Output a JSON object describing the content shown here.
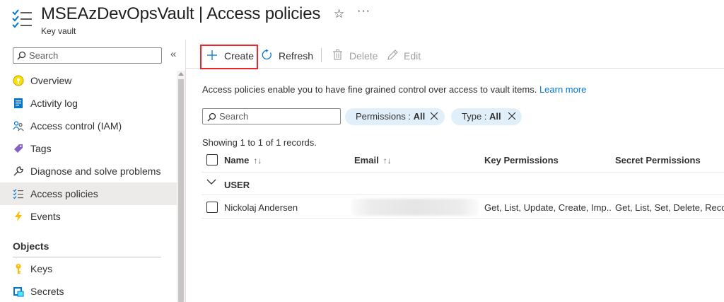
{
  "header": {
    "title": "MSEAzDevOpsVault | Access policies",
    "subtitle": "Key vault",
    "favorite_icon": "star-outline-icon",
    "more_label": "···"
  },
  "sidebar": {
    "search_placeholder": "Search",
    "collapse_label": "«",
    "items": [
      {
        "label": "Overview",
        "icon": "overview-icon",
        "selected": false
      },
      {
        "label": "Activity log",
        "icon": "activity-log-icon",
        "selected": false
      },
      {
        "label": "Access control (IAM)",
        "icon": "people-icon",
        "selected": false
      },
      {
        "label": "Tags",
        "icon": "tag-icon",
        "selected": false
      },
      {
        "label": "Diagnose and solve problems",
        "icon": "wrench-icon",
        "selected": false
      },
      {
        "label": "Access policies",
        "icon": "checklist-icon",
        "selected": true
      },
      {
        "label": "Events",
        "icon": "lightning-icon",
        "selected": false
      }
    ],
    "section_title": "Objects",
    "object_items": [
      {
        "label": "Keys",
        "icon": "key-icon"
      },
      {
        "label": "Secrets",
        "icon": "secret-icon"
      }
    ]
  },
  "toolbar": {
    "create_label": "Create",
    "refresh_label": "Refresh",
    "delete_label": "Delete",
    "edit_label": "Edit"
  },
  "content": {
    "info_text": "Access policies enable you to have fine grained control over access to vault items.",
    "learn_more": "Learn more",
    "search_placeholder": "Search",
    "filters": [
      {
        "name": "Permissions :",
        "value": "All"
      },
      {
        "name": "Type :",
        "value": "All"
      }
    ],
    "records_text": "Showing 1 to 1 of 1 records."
  },
  "table": {
    "columns": [
      "Name",
      "Email",
      "Key Permissions",
      "Secret Permissions"
    ],
    "sort_indicator": "↑↓",
    "group_label": "USER",
    "rows": [
      {
        "name": "Nickolaj Andersen",
        "key_permissions": "Get, List, Update, Create, Imp...",
        "secret_permissions": "Get, List, Set, Delete, Recov"
      }
    ]
  },
  "colors": {
    "accent": "#0078d4",
    "highlight_border": "#e8262b",
    "pill_background": "#e1effa",
    "selected_nav": "#edebe9"
  }
}
